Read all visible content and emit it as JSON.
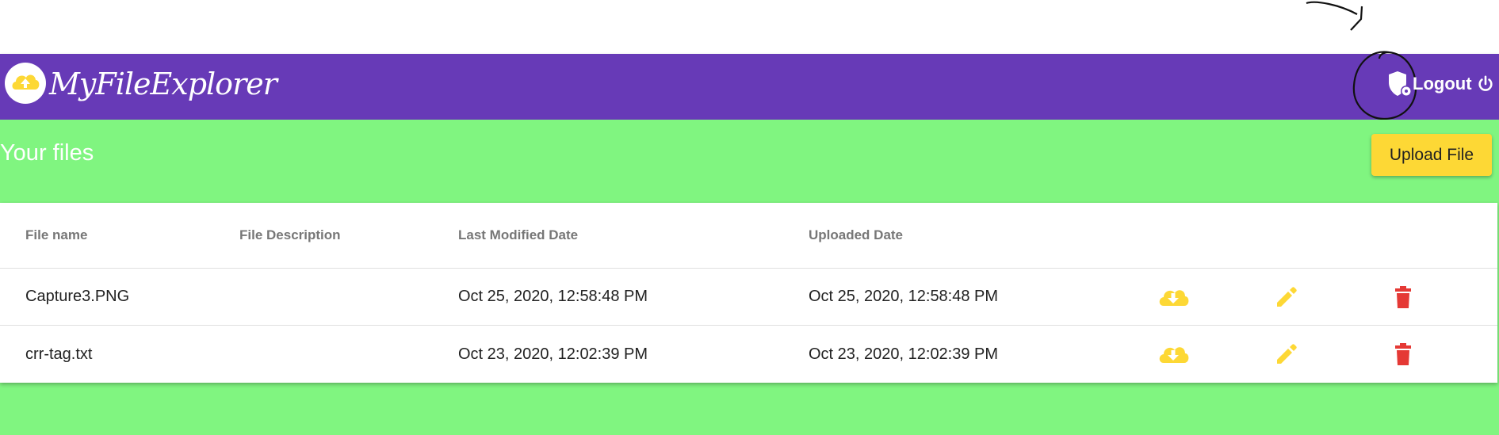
{
  "app": {
    "title": "MyFileExplorer",
    "logo_icon": "cloud-upload-icon",
    "admin_icon": "admin-shield-icon"
  },
  "header": {
    "logout_label": "Logout",
    "logout_icon": "power-icon"
  },
  "page": {
    "title": "Your files",
    "upload_label": "Upload File"
  },
  "table": {
    "columns": [
      "File name",
      "File Description",
      "Last Modified Date",
      "Uploaded Date"
    ],
    "rows": [
      {
        "name": "Capture3.PNG",
        "description": "",
        "modified": "Oct 25, 2020, 12:58:48 PM",
        "uploaded": "Oct 25, 2020, 12:58:48 PM"
      },
      {
        "name": "crr-tag.txt",
        "description": "",
        "modified": "Oct 23, 2020, 12:02:39 PM",
        "uploaded": "Oct 23, 2020, 12:02:39 PM"
      }
    ],
    "row_actions": [
      "cloud-download-icon",
      "pencil-icon",
      "trash-icon"
    ]
  },
  "colors": {
    "appbar": "#673ab7",
    "content_bg": "#80f580",
    "accent_yellow": "#fdd835",
    "delete_red": "#e53935"
  }
}
